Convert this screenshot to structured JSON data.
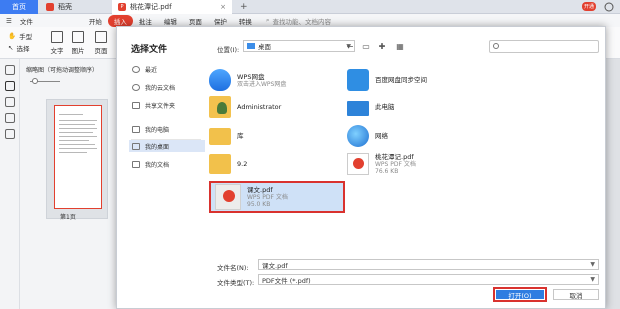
{
  "tabs": {
    "home": "首页",
    "docer": "稻壳",
    "pdf": "桃花潭记.pdf",
    "plus": "+",
    "badge": "开通"
  },
  "menu": {
    "file": "文件",
    "items": [
      "开始",
      "插入",
      "批注",
      "编辑",
      "页面",
      "保护",
      "转换"
    ],
    "active": "插入",
    "search": "查找功能、文档内容"
  },
  "toolbar": {
    "hand": "手型",
    "select": "选择",
    "text": "文字",
    "image": "图片",
    "page": "页面"
  },
  "thumbnail": {
    "title": "缩略图（可拖动调整顺序）",
    "page_label": "第1页"
  },
  "dialog": {
    "title": "选择文件",
    "location_label": "位置(I):",
    "location_value": "桌面",
    "nav": [
      "最近",
      "我的云文档",
      "共享文件夹",
      "我的电脑",
      "我的桌面",
      "我的文档"
    ],
    "nav_selected": "我的桌面",
    "files": [
      {
        "name": "WPS网盘",
        "sub": "双击进入WPS网盘",
        "icon": "cloud-drive-icon"
      },
      {
        "name": "百度网盘同步空间",
        "sub": "",
        "icon": "baidu-sync-icon"
      },
      {
        "name": "Administrator",
        "sub": "",
        "icon": "user-folder-icon"
      },
      {
        "name": "此电脑",
        "sub": "",
        "icon": "computer-icon"
      },
      {
        "name": "库",
        "sub": "",
        "icon": "library-icon"
      },
      {
        "name": "网络",
        "sub": "",
        "icon": "network-icon"
      },
      {
        "name": "9.2",
        "sub": "",
        "icon": "folder-icon"
      },
      {
        "name": "桃花潭记.pdf",
        "sub": "WPS PDF 文档",
        "sub2": "76.6 KB",
        "icon": "pdf-icon"
      }
    ],
    "selected_file": {
      "name": "课文.pdf",
      "type": "WPS PDF 文档",
      "size": "95.0 KB"
    },
    "filename_label": "文件名(N):",
    "filename_value": "课文.pdf",
    "filetype_label": "文件类型(T):",
    "filetype_value": "PDF文件 (*.pdf)",
    "open_button": "打开(O)",
    "cancel_button": "取消"
  }
}
